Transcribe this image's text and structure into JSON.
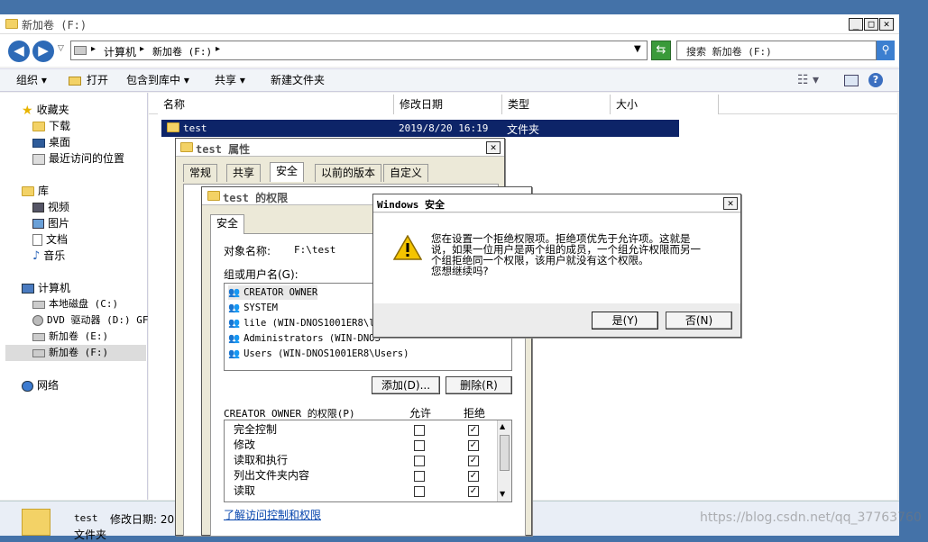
{
  "explorer": {
    "title": "新加卷 (F:)",
    "address": [
      "计算机",
      "新加卷 (F:)"
    ],
    "search_placeholder": "搜索 新加卷 (F:)",
    "menu": [
      "组织 ▾",
      "打开",
      "包含到库中 ▾",
      "共享 ▾",
      "新建文件夹"
    ],
    "columns": [
      "名称",
      "修改日期",
      "类型",
      "大小"
    ],
    "row": {
      "name": "test",
      "date": "2019/8/20 16:19",
      "type": "文件夹"
    },
    "nav": {
      "favorites": "收藏夹",
      "downloads": "下载",
      "desktop": "桌面",
      "recent": "最近访问的位置",
      "libraries": "库",
      "videos": "视频",
      "pictures": "图片",
      "docs": "文档",
      "music": "音乐",
      "computer": "计算机",
      "local_disk": "本地磁盘 (C:)",
      "dvd": "DVD 驱动器 (D:) GF",
      "vol_e": "新加卷 (E:)",
      "vol_f": "新加卷 (F:)",
      "network": "网络"
    },
    "details": {
      "name": "test",
      "date_label": "修改日期: 20",
      "type": "文件夹"
    }
  },
  "props": {
    "title": "test 属性",
    "tabs": [
      "常规",
      "共享",
      "安全",
      "以前的版本",
      "自定义"
    ]
  },
  "perm": {
    "title": "test 的权限",
    "tab": "安全",
    "object_label": "对象名称:",
    "object_value": "F:\\test",
    "group_label": "组或用户名(G):",
    "users": [
      "CREATOR OWNER",
      "SYSTEM",
      "lile (WIN-DNOS1001ER8\\li",
      "Administrators (WIN-DNOS",
      "Users (WIN-DNOS1001ER8\\Users)"
    ],
    "add_btn": "添加(D)...",
    "remove_btn": "删除(R)",
    "perm_header": "CREATOR OWNER 的权限(P)",
    "allow": "允许",
    "deny": "拒绝",
    "perms": [
      {
        "name": "完全控制",
        "allow": false,
        "deny": true
      },
      {
        "name": "修改",
        "allow": false,
        "deny": true
      },
      {
        "name": "读取和执行",
        "allow": false,
        "deny": true
      },
      {
        "name": "列出文件夹内容",
        "allow": false,
        "deny": true
      },
      {
        "name": "读取",
        "allow": false,
        "deny": true
      }
    ],
    "link": "了解访问控制和权限"
  },
  "warn": {
    "title": "Windows 安全",
    "message1": "您在设置一个拒绝权限项。拒绝项优先于允许项。这就是",
    "message2": "说，如果一位用户是两个组的成员，一个组允许权限而另一",
    "message3": "个组拒绝同一个权限，该用户就没有这个权限。",
    "message4": "您想继续吗?",
    "yes": "是(Y)",
    "no": "否(N)"
  },
  "watermark": "https://blog.csdn.net/qq_37763760"
}
